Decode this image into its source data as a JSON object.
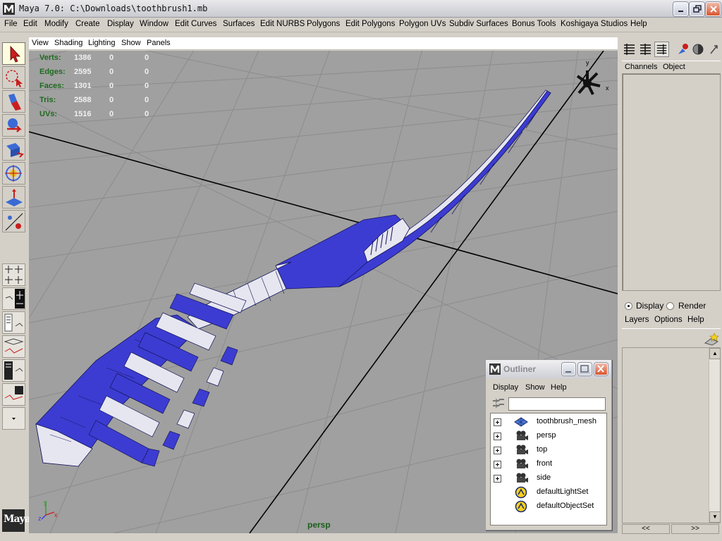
{
  "window": {
    "title": "Maya 7.0: C:\\Downloads\\toothbrush1.mb"
  },
  "menubar": {
    "items": [
      "File",
      "Edit",
      "Modify",
      "Create",
      "Display",
      "Window",
      "Edit Curves",
      "Surfaces",
      "Edit NURBS",
      "Polygons",
      "Edit Polygons",
      "Polygon UVs",
      "Subdiv Surfaces",
      "Bonus Tools",
      "Koshigaya Studios",
      "Help"
    ]
  },
  "panel_menu": {
    "items": [
      "View",
      "Shading",
      "Lighting",
      "Show",
      "Panels"
    ]
  },
  "hud": {
    "rows": [
      {
        "label": "Verts:",
        "total": "1386",
        "selected": "0",
        "components": "0"
      },
      {
        "label": "Edges:",
        "total": "2595",
        "selected": "0",
        "components": "0"
      },
      {
        "label": "Faces:",
        "total": "1301",
        "selected": "0",
        "components": "0"
      },
      {
        "label": "Tris:",
        "total": "2588",
        "selected": "0",
        "components": "0"
      },
      {
        "label": "UVs:",
        "total": "1516",
        "selected": "0",
        "components": "0"
      }
    ]
  },
  "viewport": {
    "camera": "persp",
    "axis_y": "y",
    "axis_x": "x",
    "axis_z": "z"
  },
  "channel_box": {
    "menu": [
      "Channels",
      "Object"
    ]
  },
  "layer_editor": {
    "mode_options": [
      "Display",
      "Render"
    ],
    "selected_mode": "Display",
    "menu": [
      "Layers",
      "Options",
      "Help"
    ],
    "arrows": [
      "<<",
      ">>"
    ]
  },
  "outliner": {
    "title": "Outliner",
    "menu": [
      "Display",
      "Show",
      "Help"
    ],
    "items": [
      {
        "name": "toothbrush_mesh",
        "icon": "mesh-icon",
        "expandable": true
      },
      {
        "name": "persp",
        "icon": "camera-icon",
        "expandable": true
      },
      {
        "name": "top",
        "icon": "camera-icon",
        "expandable": true
      },
      {
        "name": "front",
        "icon": "camera-icon",
        "expandable": true
      },
      {
        "name": "side",
        "icon": "camera-icon",
        "expandable": true
      },
      {
        "name": "defaultLightSet",
        "icon": "set-icon",
        "expandable": false
      },
      {
        "name": "defaultObjectSet",
        "icon": "set-icon",
        "expandable": false
      }
    ]
  },
  "logo": "Maya",
  "colors": {
    "mesh_blue": "#3c3cd2",
    "mesh_white": "#e6e6f0",
    "viewport_bg": "#a0a0a0",
    "hud_label": "#1e6a1e"
  }
}
